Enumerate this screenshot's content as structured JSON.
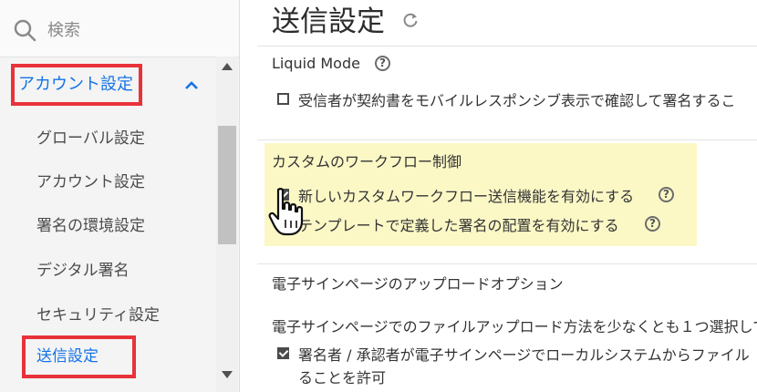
{
  "sidebar": {
    "search_placeholder": "検索",
    "section_title": "アカウント設定",
    "items": [
      {
        "label": "グローバル設定"
      },
      {
        "label": "アカウント設定"
      },
      {
        "label": "署名の環境設定"
      },
      {
        "label": "デジタル署名"
      },
      {
        "label": "セキュリティ設定"
      }
    ],
    "active_item": "送信設定"
  },
  "main": {
    "title": "送信設定",
    "liquid_mode": {
      "heading": "Liquid Mode",
      "option": "受信者が契約書をモバイルレスポンシブ表示で確認して署名するこ",
      "checked": false
    },
    "custom_workflow": {
      "heading": "カスタムのワークフロー制御",
      "option1": "新しいカスタムワークフロー送信機能を有効にする",
      "option1_checked": true,
      "option2": "テンプレートで定義した署名の配置を有効にする",
      "highlight_color": "#fbf8c6"
    },
    "esign_upload": {
      "heading": "電子サインページのアップロードオプション",
      "instruction": "電子サインページでのファイルアップロード方法を少なくとも１つ選択して",
      "option1_line1": "署名者 / 承認者が電子サインページでローカルシステムからファイル",
      "option1_line2": "ることを許可",
      "option1_checked": true
    }
  },
  "colors": {
    "accent": "#1473e6",
    "annotation_red": "#e8323a"
  }
}
